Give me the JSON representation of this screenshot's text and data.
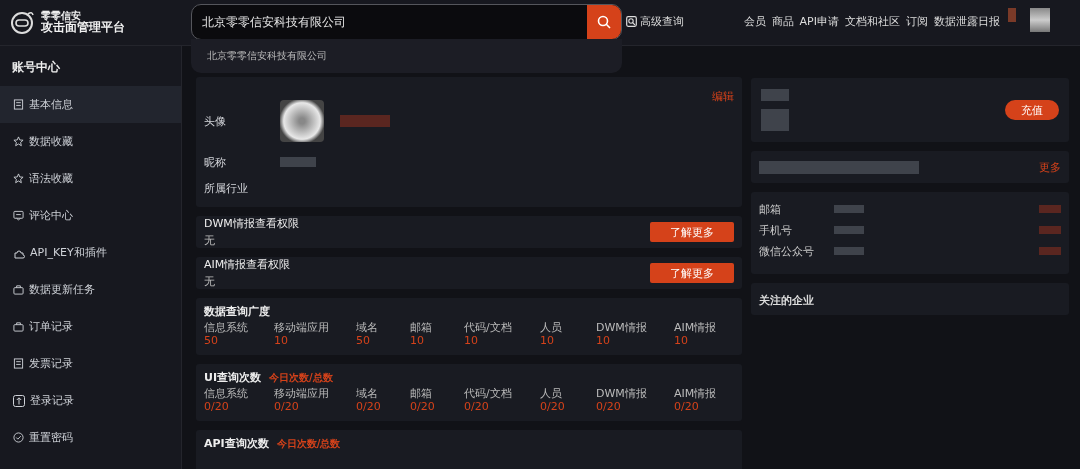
{
  "header": {
    "logo_top": "零零信安",
    "logo_bottom": "攻击面管理平台",
    "search": {
      "value": "北京零零信安科技有限公司",
      "suggestions": [
        "北京零零信安科技有限公司"
      ]
    },
    "advanced_search": "高级查询",
    "nav": [
      "会员",
      "商品",
      "API申请",
      "文档和社区",
      "订阅",
      "数据泄露日报"
    ]
  },
  "sidebar": {
    "title": "账号中心",
    "items": [
      {
        "label": "基本信息",
        "selected": true
      },
      {
        "label": "数据收藏",
        "selected": false
      },
      {
        "label": "语法收藏",
        "selected": false
      },
      {
        "label": "评论中心",
        "selected": false
      },
      {
        "label": "API_KEY和插件",
        "selected": false
      },
      {
        "label": "数据更新任务",
        "selected": false
      },
      {
        "label": "订单记录",
        "selected": false
      },
      {
        "label": "发票记录",
        "selected": false
      },
      {
        "label": "登录记录",
        "selected": false
      },
      {
        "label": "重置密码",
        "selected": false
      }
    ]
  },
  "profile": {
    "edit": "编辑",
    "fields": [
      {
        "label": "头像",
        "kind": "avatar"
      },
      {
        "label": "昵称",
        "kind": "redacted"
      },
      {
        "label": "所属行业",
        "kind": "empty"
      }
    ]
  },
  "permissions": [
    {
      "title": "DWM情报查看权限",
      "value": "无",
      "button": "了解更多"
    },
    {
      "title": "AIM情报查看权限",
      "value": "无",
      "button": "了解更多"
    }
  ],
  "quotas": [
    {
      "title": "数据查询广度",
      "columns": [
        {
          "label": "信息系统",
          "value": "50"
        },
        {
          "label": "移动端应用",
          "value": "10"
        },
        {
          "label": "域名",
          "value": "50"
        },
        {
          "label": "邮箱",
          "value": "10"
        },
        {
          "label": "代码/文档",
          "value": "10"
        },
        {
          "label": "人员",
          "value": "10"
        },
        {
          "label": "DWM情报",
          "value": "10"
        },
        {
          "label": "AIM情报",
          "value": "10"
        }
      ]
    },
    {
      "title": "UI查询次数",
      "hint": "今日次数/总数",
      "columns": [
        {
          "label": "信息系统",
          "value": "0/20"
        },
        {
          "label": "移动端应用",
          "value": "0/20"
        },
        {
          "label": "域名",
          "value": "0/20"
        },
        {
          "label": "邮箱",
          "value": "0/20"
        },
        {
          "label": "代码/文档",
          "value": "0/20"
        },
        {
          "label": "人员",
          "value": "0/20"
        },
        {
          "label": "DWM情报",
          "value": "0/20"
        },
        {
          "label": "AIM情报",
          "value": "0/20"
        }
      ]
    },
    {
      "title": "API查询次数",
      "hint": "今日次数/总数"
    }
  ],
  "account": {
    "recharge": "充值",
    "more": "更多",
    "contacts": [
      "邮箱",
      "手机号",
      "微信公众号"
    ],
    "followed": "关注的企业"
  }
}
